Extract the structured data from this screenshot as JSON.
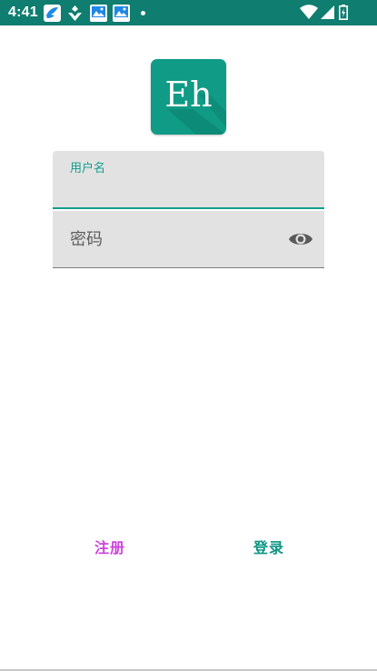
{
  "status_bar": {
    "time": "4:41",
    "notifications": [
      "feather-icon",
      "sync-icon",
      "gallery-icon",
      "gallery-icon"
    ],
    "color": "#0f7d6f"
  },
  "logo": {
    "text": "Eh",
    "color": "#0f9b86"
  },
  "form": {
    "username_label": "用户名",
    "username_value": "",
    "password_placeholder": "密码",
    "password_value": "",
    "accent_color": "#119d8b"
  },
  "actions": {
    "register_label": "注册",
    "register_color": "#cc44dd",
    "login_label": "登录",
    "login_color": "#0f9484"
  }
}
